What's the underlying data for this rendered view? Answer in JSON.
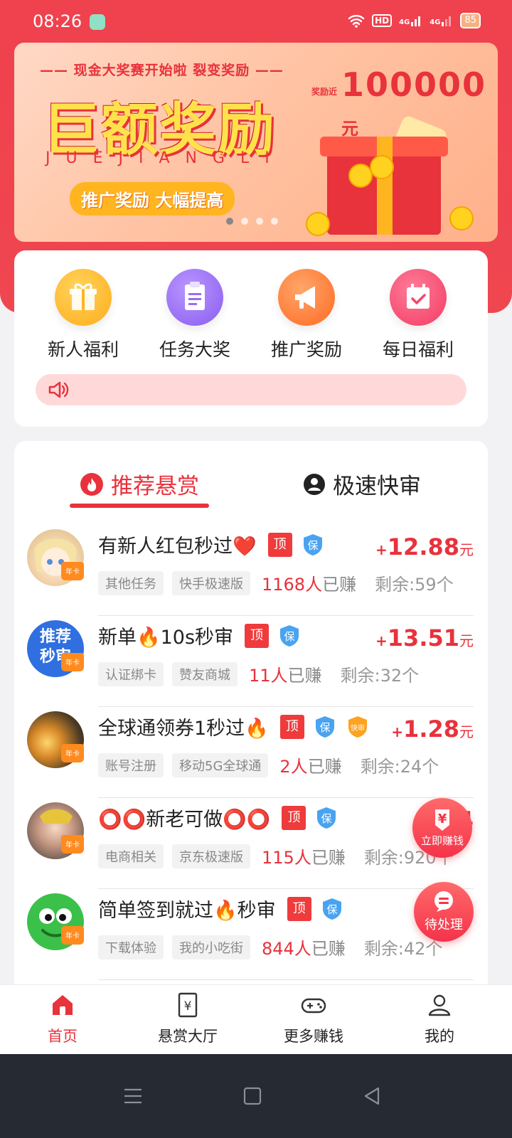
{
  "status_bar": {
    "time": "08:26",
    "network_hd": "HD",
    "net1": "4G",
    "net2": "4G",
    "battery": "85"
  },
  "banner": {
    "subtitle": "现金大奖赛开始啦  裂变奖励",
    "amount_prefix": "奖励近",
    "amount": "100000",
    "amount_unit": "元",
    "headline": "巨额奖励",
    "pinyin": "JUEJIANGLI",
    "pill": "推广奖励 大幅提高",
    "active_dot": 1,
    "dot_count": 4
  },
  "quick_actions": [
    {
      "label": "新人福利",
      "icon": "gift-icon",
      "color": "#ffb51f"
    },
    {
      "label": "任务大奖",
      "icon": "clipboard-icon",
      "color": "#9a6cf5"
    },
    {
      "label": "推广奖励",
      "icon": "megaphone-icon",
      "color": "#ff7a2e"
    },
    {
      "label": "每日福利",
      "icon": "calendar-check-icon",
      "color": "#f4476a"
    }
  ],
  "notice": {
    "icon": "speaker-icon",
    "text": ""
  },
  "tabs": [
    {
      "label": "推荐悬赏",
      "icon": "flame-icon",
      "active": true
    },
    {
      "label": "极速快审",
      "icon": "person-icon",
      "active": false
    }
  ],
  "tasks": [
    {
      "title": "有新人红包秒过❤️",
      "badges": [
        "顶",
        "保"
      ],
      "price_plus": "+",
      "price": "12.88",
      "unit": "元",
      "tags": [
        "其他任务",
        "快手极速版"
      ],
      "earned_count": "1168人",
      "earned_label": "已赚",
      "remaining": "剩余:59个",
      "avatar": "anime-girl",
      "avatar_text": "",
      "badge_year": "年卡"
    },
    {
      "title": "新单🔥10s秒审",
      "badges": [
        "顶",
        "保"
      ],
      "price_plus": "+",
      "price": "13.51",
      "unit": "元",
      "tags": [
        "认证绑卡",
        "赞友商城"
      ],
      "earned_count": "11人",
      "earned_label": "已赚",
      "remaining": "剩余:32个",
      "avatar": "blue-text",
      "avatar_text": "推荐秒审",
      "badge_year": "年卡"
    },
    {
      "title": "全球通领券1秒过🔥",
      "badges": [
        "顶",
        "保",
        "快审"
      ],
      "price_plus": "+",
      "price": "1.28",
      "unit": "元",
      "tags": [
        "账号注册",
        "移动5G全球通"
      ],
      "earned_count": "2人",
      "earned_label": "已赚",
      "remaining": "剩余:24个",
      "avatar": "sunset",
      "avatar_text": "",
      "badge_year": "年卡"
    },
    {
      "title": "⭕⭕新老可做⭕⭕",
      "badges": [
        "顶",
        "保"
      ],
      "price_plus": "+",
      "price": "4",
      "unit": "",
      "tags": [
        "电商相关",
        "京东极速版"
      ],
      "earned_count": "115人",
      "earned_label": "已赚",
      "remaining": "剩余:920个",
      "avatar": "girl-photo",
      "avatar_text": "",
      "badge_year": "年卡"
    },
    {
      "title": "简单签到就过🔥秒审",
      "badges": [
        "顶",
        "保"
      ],
      "price_plus": "+",
      "price": "3",
      "unit": "",
      "tags": [
        "下载体验",
        "我的小吃街"
      ],
      "earned_count": "844人",
      "earned_label": "已赚",
      "remaining": "剩余:42个",
      "avatar": "frog",
      "avatar_text": "",
      "badge_year": "年卡"
    }
  ],
  "floating": {
    "earn_now": "立即赚钱",
    "earn_now_icon": "yen-icon",
    "pending": "待处理",
    "pending_icon": "chat-icon"
  },
  "bottom_nav": [
    {
      "label": "首页",
      "icon": "home-icon",
      "active": true
    },
    {
      "label": "悬赏大厅",
      "icon": "yen-document-icon",
      "active": false
    },
    {
      "label": "更多赚钱",
      "icon": "gamepad-icon",
      "active": false
    },
    {
      "label": "我的",
      "icon": "user-icon",
      "active": false
    }
  ],
  "colors": {
    "primary": "#e8323c",
    "accent_yellow": "#ffb51f",
    "text_dark": "#222222",
    "muted": "#888888"
  }
}
